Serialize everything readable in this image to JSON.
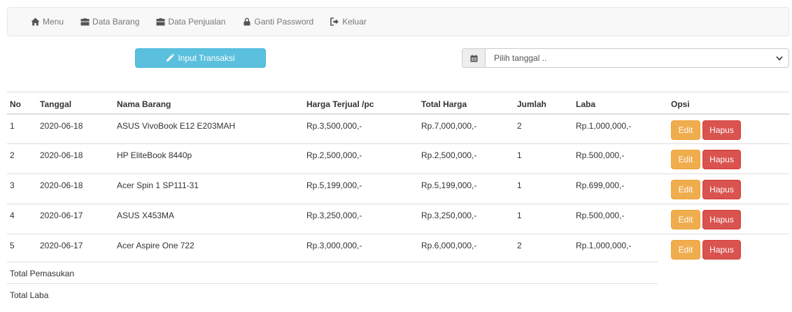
{
  "nav": {
    "items": [
      {
        "label": "Menu",
        "icon": "home-icon"
      },
      {
        "label": "Data Barang",
        "icon": "briefcase-icon"
      },
      {
        "label": "Data Penjualan",
        "icon": "briefcase-icon"
      },
      {
        "label": "Ganti Password",
        "icon": "lock-icon"
      },
      {
        "label": "Keluar",
        "icon": "log-out-icon"
      }
    ]
  },
  "toolbar": {
    "input_label": "Input Transaksi",
    "date_placeholder": "Pilih tanggal .."
  },
  "table": {
    "headers": [
      "No",
      "Tanggal",
      "Nama Barang",
      "Harga Terjual /pc",
      "Total Harga",
      "Jumlah",
      "Laba",
      "Opsi"
    ],
    "rows": [
      [
        "1",
        "2020-06-18",
        "ASUS VivoBook E12 E203MAH",
        "Rp.3,500,000,-",
        "Rp.7,000,000,-",
        "2",
        "Rp.1,000,000,-"
      ],
      [
        "2",
        "2020-06-18",
        "HP EliteBook 8440p",
        "Rp.2,500,000,-",
        "Rp.2,500,000,-",
        "1",
        "Rp.500,000,-"
      ],
      [
        "3",
        "2020-06-18",
        "Acer Spin 1 SP111-31",
        "Rp.5,199,000,-",
        "Rp.5,199,000,-",
        "1",
        "Rp.699,000,-"
      ],
      [
        "4",
        "2020-06-17",
        "ASUS X453MA",
        "Rp.3,250,000,-",
        "Rp.3,250,000,-",
        "1",
        "Rp.500,000,-"
      ],
      [
        "5",
        "2020-06-17",
        "Acer Aspire One 722",
        "Rp.3,000,000,-",
        "Rp.6,000,000,-",
        "2",
        "Rp.1,000,000,-"
      ]
    ],
    "edit_label": "Edit",
    "hapus_label": "Hapus"
  },
  "footer": {
    "total_pemasukan": "Total Pemasukan",
    "total_laba": "Total Laba"
  },
  "colors": {
    "info": "#5bc0de",
    "warning": "#f0ad4e",
    "danger": "#d9534f"
  }
}
